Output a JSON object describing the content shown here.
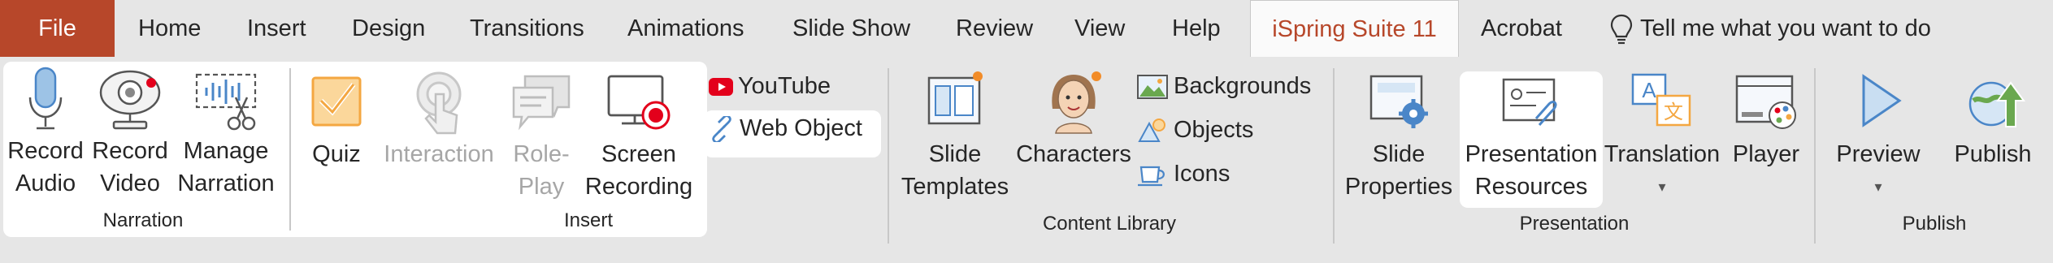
{
  "tabs": {
    "file": "File",
    "home": "Home",
    "insert": "Insert",
    "design": "Design",
    "transitions": "Transitions",
    "animations": "Animations",
    "slideshow": "Slide Show",
    "review": "Review",
    "view": "View",
    "help": "Help",
    "ispring": "iSpring Suite 11",
    "acrobat": "Acrobat",
    "tellme": "Tell me what you want to do"
  },
  "narration": {
    "record_audio": [
      "Record",
      "Audio"
    ],
    "record_video": [
      "Record",
      "Video"
    ],
    "manage": [
      "Manage",
      "Narration"
    ],
    "label": "Narration"
  },
  "insert": {
    "quiz": "Quiz",
    "interaction": "Interaction",
    "roleplay": [
      "Role-",
      "Play"
    ],
    "screen": [
      "Screen",
      "Recording"
    ],
    "youtube": "YouTube",
    "webobject": "Web Object",
    "label": "Insert"
  },
  "content": {
    "templates": [
      "Slide",
      "Templates"
    ],
    "characters": "Characters",
    "backgrounds": "Backgrounds",
    "objects": "Objects",
    "icons": "Icons",
    "label": "Content Library"
  },
  "presentation": {
    "properties": [
      "Slide",
      "Properties"
    ],
    "resources": [
      "Presentation",
      "Resources"
    ],
    "translation": "Translation",
    "player": "Player",
    "label": "Presentation"
  },
  "publish": {
    "preview": "Preview",
    "publish": "Publish",
    "label": "Publish"
  },
  "colors": {
    "file_bg": "#b7472a",
    "active_tab_text": "#b7472a",
    "ribbon_bg": "#e6e6e6",
    "accent_blue": "#4a86c8",
    "record_red": "#e3001b",
    "quiz_orange": "#f4a741"
  }
}
